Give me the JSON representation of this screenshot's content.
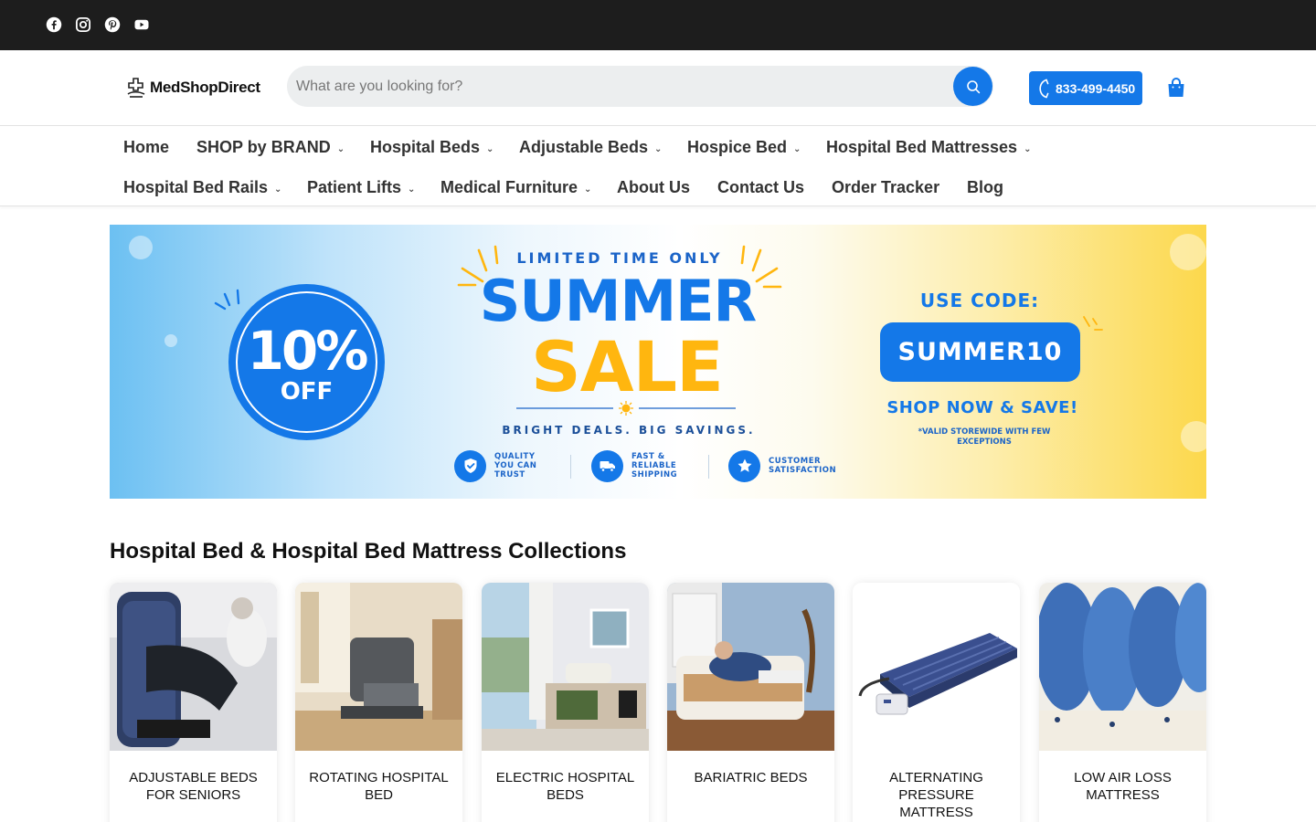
{
  "topbar": {
    "social_icons": [
      "facebook-icon",
      "instagram-icon",
      "pinterest-icon",
      "youtube-icon"
    ]
  },
  "header": {
    "logo_text": "MedShopDirect",
    "search_placeholder": "What are you looking for?",
    "phone": "833-499-4450",
    "cart_icon": "shopping-bag-icon"
  },
  "nav": {
    "items": [
      {
        "label": "Home"
      },
      {
        "label": "SHOP by BRAND"
      },
      {
        "label": "Hospital Beds"
      },
      {
        "label": "Adjustable Beds"
      },
      {
        "label": "Hospice Bed"
      },
      {
        "label": "Hospital Bed Mattresses"
      },
      {
        "label": "Hospital Bed Rails"
      },
      {
        "label": "Patient Lifts"
      },
      {
        "label": "Medical Furniture"
      },
      {
        "label": "About Us"
      },
      {
        "label": "Contact Us"
      },
      {
        "label": "Order Tracker"
      },
      {
        "label": "Blog"
      }
    ],
    "dropdown_glyph": "⌄"
  },
  "banner": {
    "discount_value": "10%",
    "discount_word": "OFF",
    "kicker": "LIMITED TIME ONLY",
    "headline_top": "SUMMER",
    "headline_bottom": "SALE",
    "tagline": "BRIGHT DEALS. BIG SAVINGS.",
    "features": [
      {
        "line1": "QUALITY",
        "line2": "YOU CAN",
        "line3": "TRUST"
      },
      {
        "line1": "FAST &",
        "line2": "RELIABLE",
        "line3": "SHIPPING"
      },
      {
        "line1": "CUSTOMER",
        "line2": "SATISFACTION",
        "line3": ""
      }
    ],
    "use_code_label": "USE CODE:",
    "promo_code": "SUMMER10",
    "cta": "SHOP NOW & SAVE!",
    "disclaimer": "*VALID STOREWIDE WITH FEW EXCEPTIONS",
    "colors": {
      "blue": "#1478e8",
      "yellow": "#ffb60f"
    }
  },
  "collections": {
    "title": "Hospital Bed & Hospital Bed Mattress Collections",
    "cards": [
      {
        "label": "ADJUSTABLE BEDS FOR SENIORS"
      },
      {
        "label": "ROTATING HOSPITAL BED"
      },
      {
        "label": "ELECTRIC HOSPITAL BEDS"
      },
      {
        "label": "BARIATRIC BEDS"
      },
      {
        "label": "ALTERNATING PRESSURE MATTRESS"
      },
      {
        "label": "LOW AIR LOSS MATTRESS"
      }
    ]
  }
}
